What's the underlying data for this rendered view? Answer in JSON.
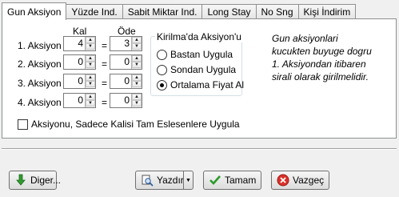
{
  "tabs": [
    "Gun Aksiyon",
    "Yüzde Ind.",
    "Sabit Miktar Ind.",
    "Long Stay",
    "No Sng",
    "Kişi İndirim"
  ],
  "columns": {
    "kal": "Kal",
    "ode": "Öde"
  },
  "rows": [
    {
      "label": "1. Aksiyon",
      "kal": "4",
      "ode": "3"
    },
    {
      "label": "2. Aksiyon",
      "kal": "0",
      "ode": "0"
    },
    {
      "label": "3. Aksiyon",
      "kal": "0",
      "ode": "0"
    },
    {
      "label": "4. Aksiyon",
      "kal": "0",
      "ode": "0"
    }
  ],
  "equals": "=",
  "group": {
    "title": "Kirilma'da Aksiyon'u",
    "options": [
      {
        "label": "Bastan Uygula",
        "checked": false
      },
      {
        "label": "Sondan Uygula",
        "checked": false
      },
      {
        "label": "Ortalama Fiyat Al",
        "checked": true
      }
    ]
  },
  "note": [
    "Gun aksiyonlari",
    "kucukten buyuge dogru",
    "1. Aksiyondan itibaren",
    "sirali olarak girilmelidir."
  ],
  "checkbox": {
    "label": "Aksiyonu, Sadece Kalisi Tam Eslesenlere Uygula",
    "checked": false
  },
  "buttons": {
    "diger": "Diger...",
    "yazdir": "Yazdır",
    "tamam": "Tamam",
    "vazgec": "Vazgeç"
  }
}
